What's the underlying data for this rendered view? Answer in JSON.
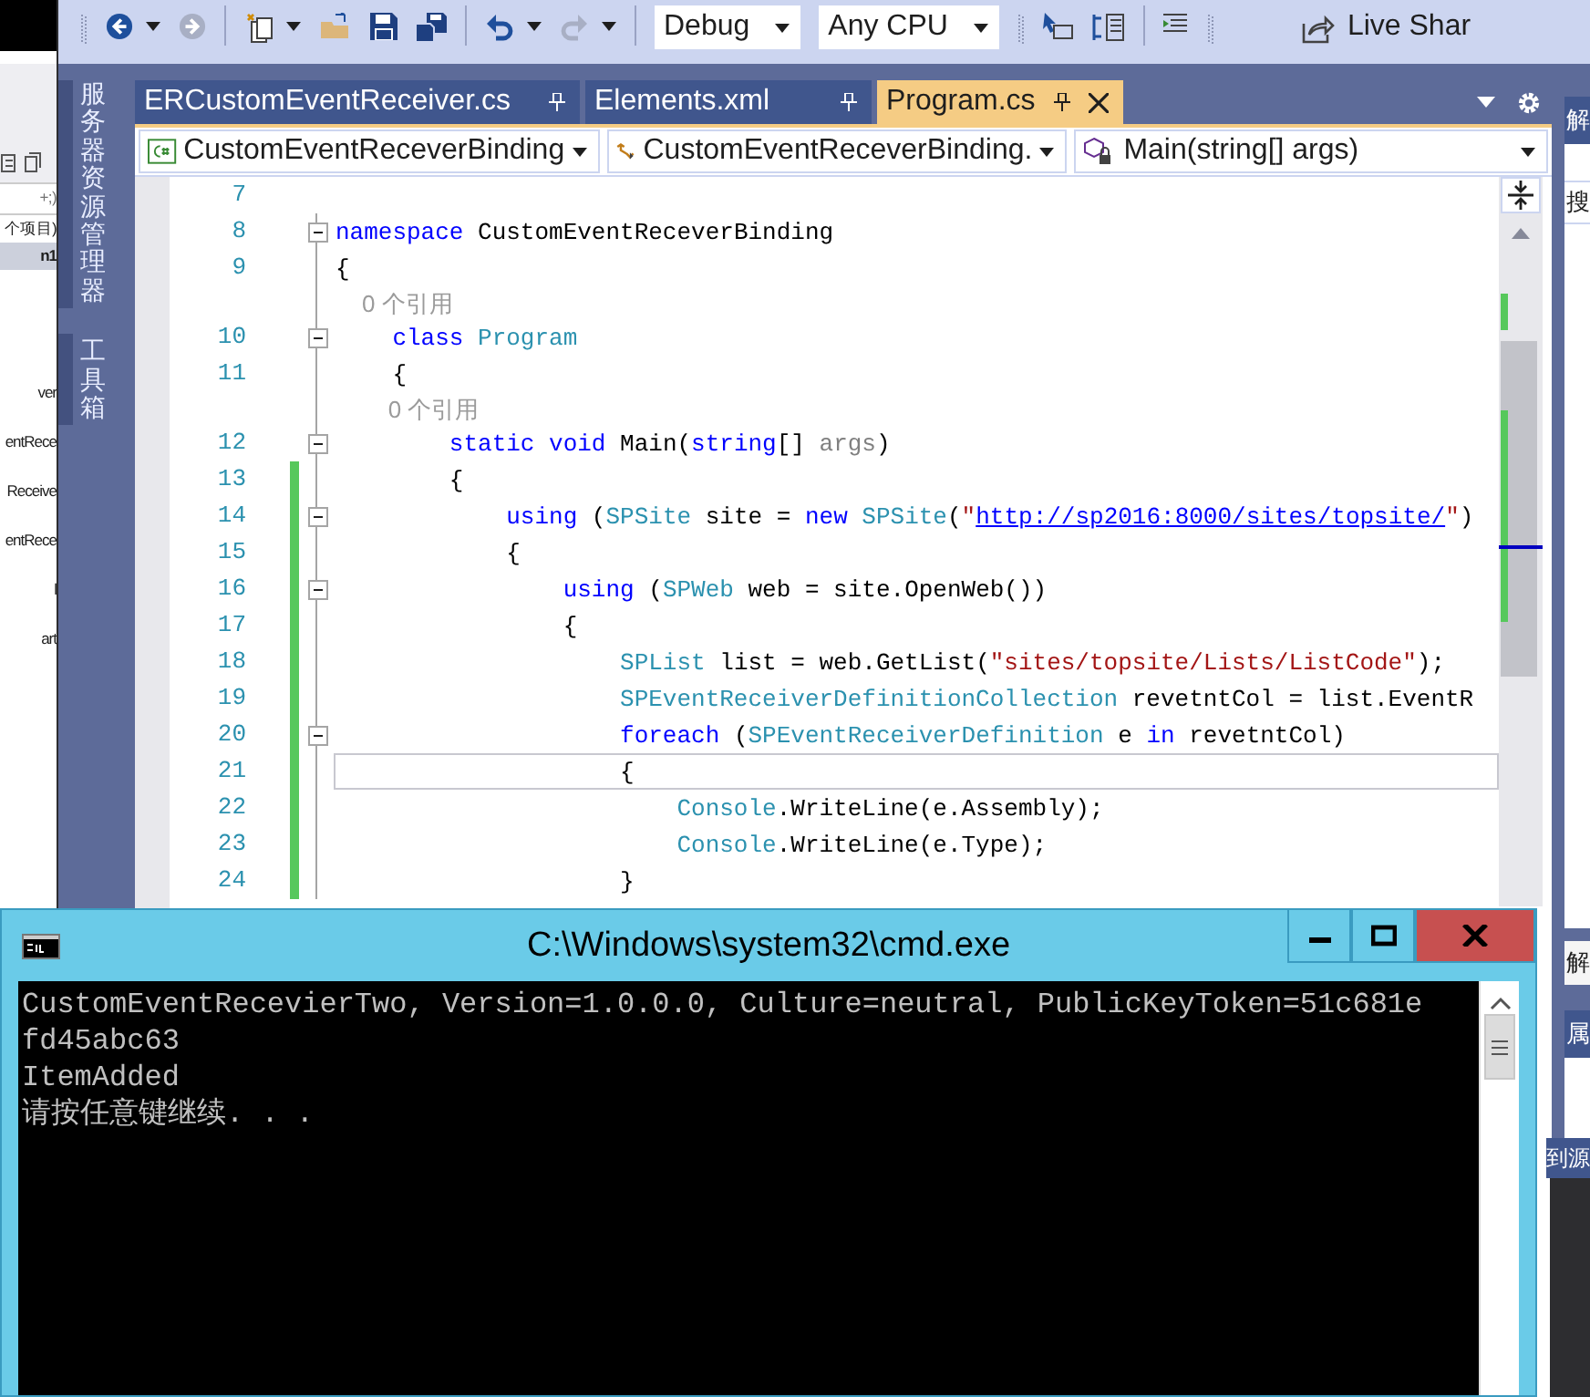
{
  "left_window": {
    "search": "+;)",
    "count": "个项目)",
    "items": [
      {
        "text": "n1",
        "selected": true
      },
      {
        "text": "ver",
        "selected": false
      },
      {
        "text": "entRece",
        "selected": false
      },
      {
        "text": "Receive",
        "selected": false
      },
      {
        "text": "entRece",
        "selected": false
      },
      {
        "text": "l",
        "selected": false
      },
      {
        "text": "art",
        "selected": false
      }
    ]
  },
  "toolbar": [
    {
      "kind": "grip"
    },
    {
      "kind": "back",
      "disabled": false
    },
    {
      "kind": "caret"
    },
    {
      "kind": "forward",
      "disabled": true
    },
    {
      "kind": "sep"
    },
    {
      "kind": "new"
    },
    {
      "kind": "caret"
    },
    {
      "kind": "open"
    },
    {
      "kind": "save"
    },
    {
      "kind": "save-all"
    },
    {
      "kind": "sep"
    },
    {
      "kind": "undo",
      "disabled": false
    },
    {
      "kind": "caret"
    },
    {
      "kind": "redo",
      "disabled": true
    },
    {
      "kind": "caret"
    },
    {
      "kind": "sep"
    },
    {
      "kind": "dropdown",
      "value": "Debug"
    },
    {
      "kind": "dropdown",
      "value": "Any CPU"
    },
    {
      "kind": "grip"
    },
    {
      "kind": "step"
    },
    {
      "kind": "list"
    },
    {
      "kind": "sep"
    },
    {
      "kind": "indent"
    },
    {
      "kind": "grip"
    },
    {
      "kind": "share",
      "label": "Live Shar"
    }
  ],
  "side_tabs": [
    {
      "label": "服务器资源管理器"
    },
    {
      "label": "工具箱"
    }
  ],
  "tabs": [
    {
      "label": "ERCustomEventReceiver.cs",
      "selected": false
    },
    {
      "label": "Elements.xml",
      "selected": false
    },
    {
      "label": "Program.cs",
      "selected": true
    }
  ],
  "navigation": [
    {
      "kind": "project",
      "value": "CustomEventReceverBinding"
    },
    {
      "kind": "class",
      "value": "CustomEventReceverBinding."
    },
    {
      "kind": "method",
      "value": "Main(string[] args)"
    }
  ],
  "lines": [
    {
      "kind": "code",
      "number": "7",
      "fold": false,
      "changed": false,
      "current": false
    },
    {
      "kind": "code",
      "number": "8",
      "fold": true,
      "changed": false,
      "current": false,
      "tokens": [
        {
          "kind": "kw",
          "text": "namespace"
        },
        {
          "kind": "plain",
          "text": " CustomEventReceverBinding"
        }
      ]
    },
    {
      "kind": "code",
      "number": "9",
      "fold": false,
      "changed": false,
      "current": false,
      "tokens": [
        {
          "kind": "plain",
          "text": "{"
        }
      ]
    },
    {
      "kind": "lens",
      "text": "    0 个引用"
    },
    {
      "kind": "code",
      "number": "10",
      "fold": true,
      "changed": false,
      "current": false,
      "tokens": [
        {
          "kind": "kw",
          "text": "    class"
        },
        {
          "kind": "type",
          "text": " Program"
        }
      ]
    },
    {
      "kind": "code",
      "number": "11",
      "fold": false,
      "changed": false,
      "current": false,
      "tokens": [
        {
          "kind": "plain",
          "text": "    {"
        }
      ]
    },
    {
      "kind": "lens",
      "text": "        0 个引用"
    },
    {
      "kind": "code",
      "number": "12",
      "fold": true,
      "changed": false,
      "current": false,
      "tokens": [
        {
          "kind": "kw",
          "text": "        static void"
        },
        {
          "kind": "plain",
          "text": " Main("
        },
        {
          "kind": "kw",
          "text": "string"
        },
        {
          "kind": "plain",
          "text": "[] "
        },
        {
          "kind": "param",
          "text": "args"
        },
        {
          "kind": "plain",
          "text": ")"
        }
      ]
    },
    {
      "kind": "code",
      "number": "13",
      "fold": false,
      "changed": true,
      "current": false,
      "tokens": [
        {
          "kind": "plain",
          "text": "        {"
        }
      ]
    },
    {
      "kind": "code",
      "number": "14",
      "fold": true,
      "changed": true,
      "current": false,
      "tokens": [
        {
          "kind": "kw",
          "text": "            using"
        },
        {
          "kind": "plain",
          "text": " ("
        },
        {
          "kind": "type",
          "text": "SPSite"
        },
        {
          "kind": "plain",
          "text": " site = "
        },
        {
          "kind": "kw",
          "text": "new"
        },
        {
          "kind": "type",
          "text": " SPSite"
        },
        {
          "kind": "plain",
          "text": "("
        },
        {
          "kind": "str",
          "text": "\""
        },
        {
          "kind": "url",
          "text": "http://sp2016:8000/sites/topsite/"
        },
        {
          "kind": "str",
          "text": "\""
        },
        {
          "kind": "plain",
          "text": ")"
        }
      ]
    },
    {
      "kind": "code",
      "number": "15",
      "fold": false,
      "changed": true,
      "current": false,
      "tokens": [
        {
          "kind": "plain",
          "text": "            {"
        }
      ]
    },
    {
      "kind": "code",
      "number": "16",
      "fold": true,
      "changed": true,
      "current": false,
      "tokens": [
        {
          "kind": "kw",
          "text": "                using"
        },
        {
          "kind": "plain",
          "text": " ("
        },
        {
          "kind": "type",
          "text": "SPWeb"
        },
        {
          "kind": "plain",
          "text": " web = site.OpenWeb())"
        }
      ]
    },
    {
      "kind": "code",
      "number": "17",
      "fold": false,
      "changed": true,
      "current": false,
      "tokens": [
        {
          "kind": "plain",
          "text": "                {"
        }
      ]
    },
    {
      "kind": "code",
      "number": "18",
      "fold": false,
      "changed": true,
      "current": false,
      "tokens": [
        {
          "kind": "type",
          "text": "                    SPList"
        },
        {
          "kind": "plain",
          "text": " list = web.GetList("
        },
        {
          "kind": "str",
          "text": "\"sites/topsite/Lists/ListCode\""
        },
        {
          "kind": "plain",
          "text": ");"
        }
      ]
    },
    {
      "kind": "code",
      "number": "19",
      "fold": false,
      "changed": true,
      "current": false,
      "tokens": [
        {
          "kind": "type",
          "text": "                    SPEventReceiverDefinitionCollection"
        },
        {
          "kind": "plain",
          "text": " revetntCol = list.EventR"
        }
      ]
    },
    {
      "kind": "code",
      "number": "20",
      "fold": true,
      "changed": true,
      "current": false,
      "tokens": [
        {
          "kind": "kw",
          "text": "                    foreach"
        },
        {
          "kind": "plain",
          "text": " ("
        },
        {
          "kind": "type",
          "text": "SPEventReceiverDefinition"
        },
        {
          "kind": "plain",
          "text": " e "
        },
        {
          "kind": "kw",
          "text": "in"
        },
        {
          "kind": "plain",
          "text": " revetntCol)"
        }
      ]
    },
    {
      "kind": "code",
      "number": "21",
      "fold": false,
      "changed": true,
      "current": true,
      "tokens": [
        {
          "kind": "plain",
          "text": "                    {"
        }
      ]
    },
    {
      "kind": "code",
      "number": "22",
      "fold": false,
      "changed": true,
      "current": false,
      "tokens": [
        {
          "kind": "type",
          "text": "                        Console"
        },
        {
          "kind": "plain",
          "text": ".WriteLine(e.Assembly);"
        }
      ]
    },
    {
      "kind": "code",
      "number": "23",
      "fold": false,
      "changed": true,
      "current": false,
      "tokens": [
        {
          "kind": "type",
          "text": "                        Console"
        },
        {
          "kind": "plain",
          "text": ".WriteLine(e.Type);"
        }
      ]
    },
    {
      "kind": "code",
      "number": "24",
      "fold": false,
      "changed": true,
      "current": false,
      "tokens": [
        {
          "kind": "plain",
          "text": "                    }"
        }
      ]
    }
  ],
  "right_panel": {
    "title": "解",
    "search": "搜",
    "bottom_tab": "解",
    "properties_title": "属",
    "status": "到源"
  },
  "console": {
    "title": "C:\\Windows\\system32\\cmd.exe",
    "lines": [
      "CustomEventRecevierTwo, Version=1.0.0.0, Culture=neutral, PublicKeyToken=51c681e",
      "fd45abc63",
      "ItemAdded",
      "请按任意键继续. . ."
    ]
  }
}
